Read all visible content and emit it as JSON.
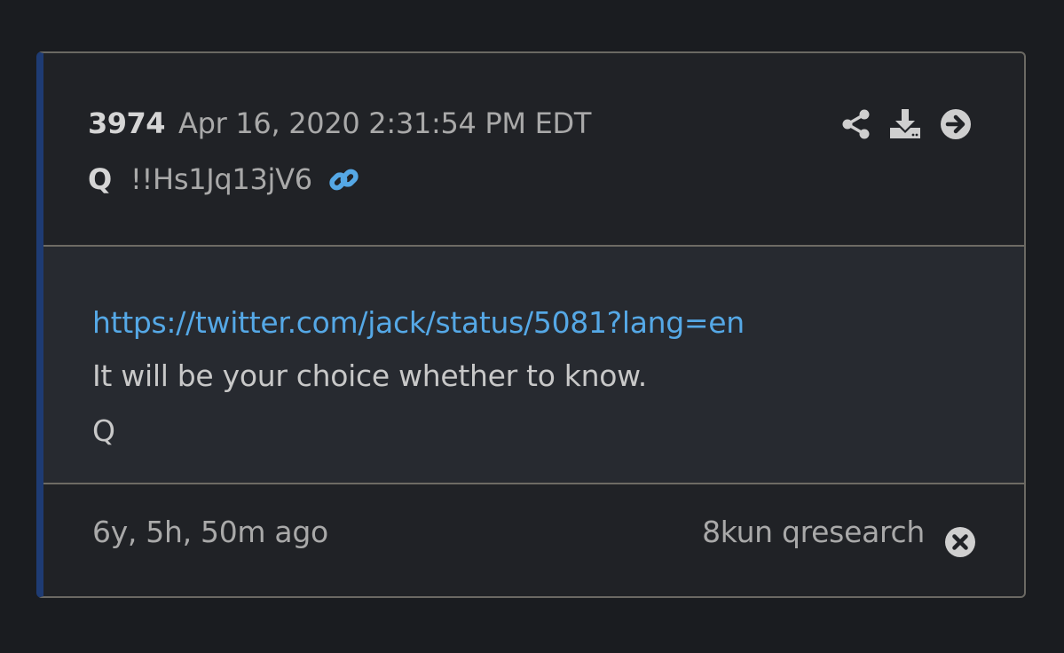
{
  "post": {
    "number": "3974",
    "timestamp": "Apr 16, 2020 2:31:54 PM EDT",
    "author": "Q",
    "tripcode": "!!Hs1Jq13jV6"
  },
  "icons": {
    "link": "link-icon",
    "share": "share-icon",
    "download": "download-icon",
    "open": "arrow-circle-right-icon",
    "close": "close-circle-icon"
  },
  "body": {
    "lines": [
      "https://twitter.com/jack/status/5081?lang=en",
      "It will be your choice whether to know.",
      "Q"
    ]
  },
  "footer": {
    "age": "6y, 5h, 50m ago",
    "source": "8kun qresearch"
  },
  "colors": {
    "accent_border": "#1e3b73",
    "link": "#55a8e6",
    "background": "#1a1c20"
  }
}
